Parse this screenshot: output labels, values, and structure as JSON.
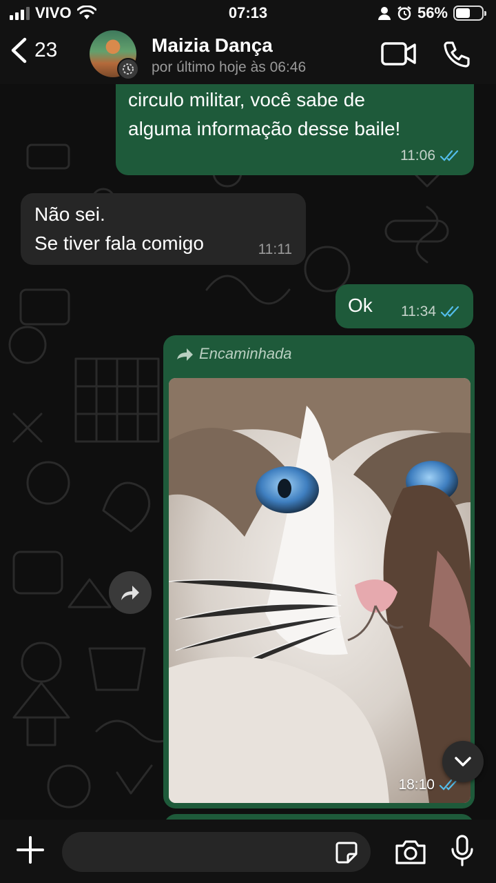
{
  "status_bar": {
    "carrier": "VIVO",
    "time": "07:13",
    "battery_percent": "56%",
    "battery_level": 0.56
  },
  "header": {
    "back_count": "23",
    "contact_name": "Maizia Dança",
    "last_seen": "por último hoje às 06:46",
    "icons": [
      "chevron-left-icon",
      "video-call-icon",
      "phone-icon"
    ]
  },
  "messages": [
    {
      "direction": "outgoing",
      "text": "circulo militar, você sabe de\nalguma informação desse baile!",
      "time": "11:06",
      "status": "read"
    },
    {
      "direction": "incoming",
      "text": "Não  sei.\nSe tiver fala comigo",
      "time": "11:11"
    },
    {
      "direction": "outgoing",
      "text": "Ok",
      "time": "11:34",
      "status": "read"
    },
    {
      "direction": "outgoing",
      "type": "image",
      "forwarded_label": "Encaminhada",
      "time": "18:10",
      "status": "read"
    }
  ],
  "colors": {
    "outgoing_bubble": "#1e5a3a",
    "incoming_bubble": "#262626",
    "read_ticks": "#53bdeb",
    "header_bg": "#121212"
  },
  "input": {
    "value": "",
    "placeholder": ""
  }
}
